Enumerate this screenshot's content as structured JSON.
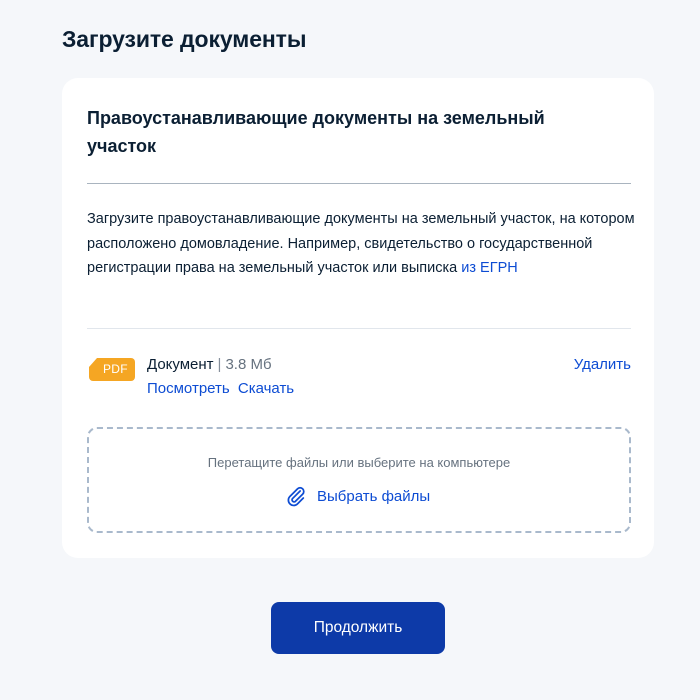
{
  "page": {
    "title": "Загрузите документы"
  },
  "card": {
    "title": "Правоустанавливающие документы на земельный участок",
    "description": "Загрузите правоустанавливающие документы на земельный участок, на котором расположено домовладение. Например, свидетельство о государственной регистрации права на земельный участок или выписка ",
    "description_link": "из ЕГРН"
  },
  "file": {
    "badge": "PDF",
    "badge_color": "#f5a623",
    "name": "Документ",
    "separator": "|",
    "size": "3.8 Мб",
    "view_label": "Посмотреть",
    "download_label": "Скачать",
    "delete_label": "Удалить"
  },
  "dropzone": {
    "hint": "Перетащите файлы или выберите на компьютере",
    "choose_label": "Выбрать файлы",
    "icon": "paperclip-icon"
  },
  "actions": {
    "continue_label": "Продолжить"
  },
  "colors": {
    "accent": "#0d4cd3",
    "primary_button": "#0d3aa8",
    "background": "#f5f7fa",
    "text": "#0b1f33"
  }
}
